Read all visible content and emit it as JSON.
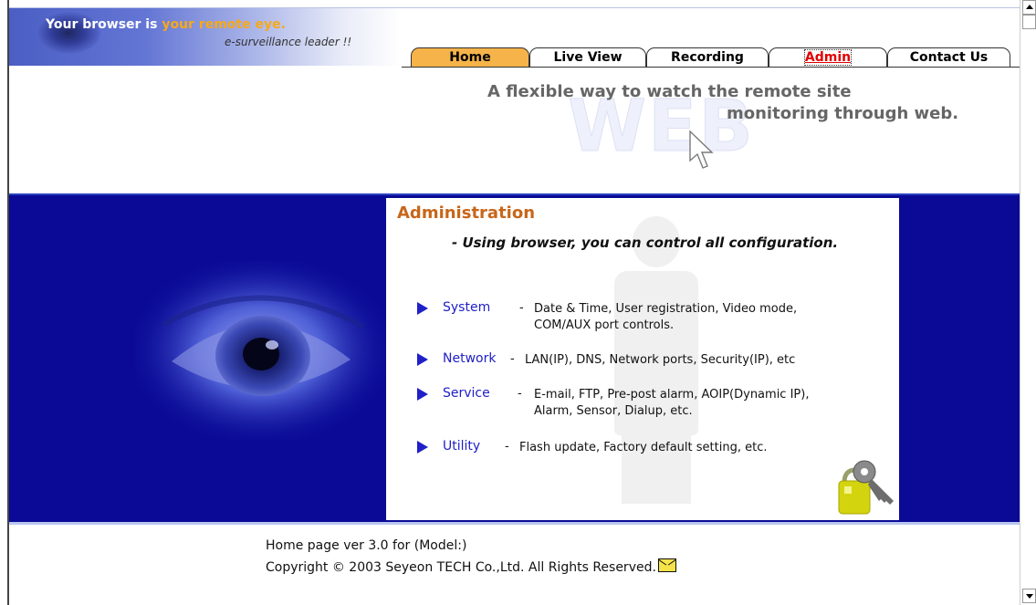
{
  "header": {
    "brand_line1_a": "Your browser is ",
    "brand_line1_b": "your remote eye.",
    "brand_line2": "e-surveillance leader !!",
    "slogan_line1": "A flexible way to watch the remote site",
    "slogan_line2": "monitoring through web.",
    "watermark": "WEB"
  },
  "tabs": [
    {
      "label": "Home",
      "active": true
    },
    {
      "label": "Live View",
      "active": false
    },
    {
      "label": "Recording",
      "active": false
    },
    {
      "label": "Admin",
      "active": false
    },
    {
      "label": "Contact Us",
      "active": false
    }
  ],
  "main": {
    "title": "Administration",
    "subtitle": "- Using browser, you can control all configuration.",
    "items": [
      {
        "name": "System",
        "dash": "-",
        "desc_line1": "Date & Time, User registration, Video mode,",
        "desc_line2": "COM/AUX port controls."
      },
      {
        "name": "Network",
        "dash": "-",
        "desc_line1": "LAN(IP), DNS, Network ports, Security(IP), etc",
        "desc_line2": ""
      },
      {
        "name": "Service",
        "dash": "-",
        "desc_line1": "E-mail, FTP, Pre-post alarm, AOIP(Dynamic IP),",
        "desc_line2": "Alarm, Sensor, Dialup, etc."
      },
      {
        "name": "Utility",
        "dash": "-",
        "desc_line1": "Flash update, Factory default setting, etc.",
        "desc_line2": ""
      }
    ]
  },
  "footer": {
    "line1": "Home page ver 3.0 for (Model:)",
    "line2": "Copyright © 2003 Seyeon TECH Co.,Ltd. All Rights Reserved."
  },
  "colors": {
    "band_blue": "#0a0a96",
    "tab_active": "#f5b34a",
    "title_orange": "#c8661a",
    "link_blue": "#2020c8",
    "admin_red": "#e00000"
  }
}
